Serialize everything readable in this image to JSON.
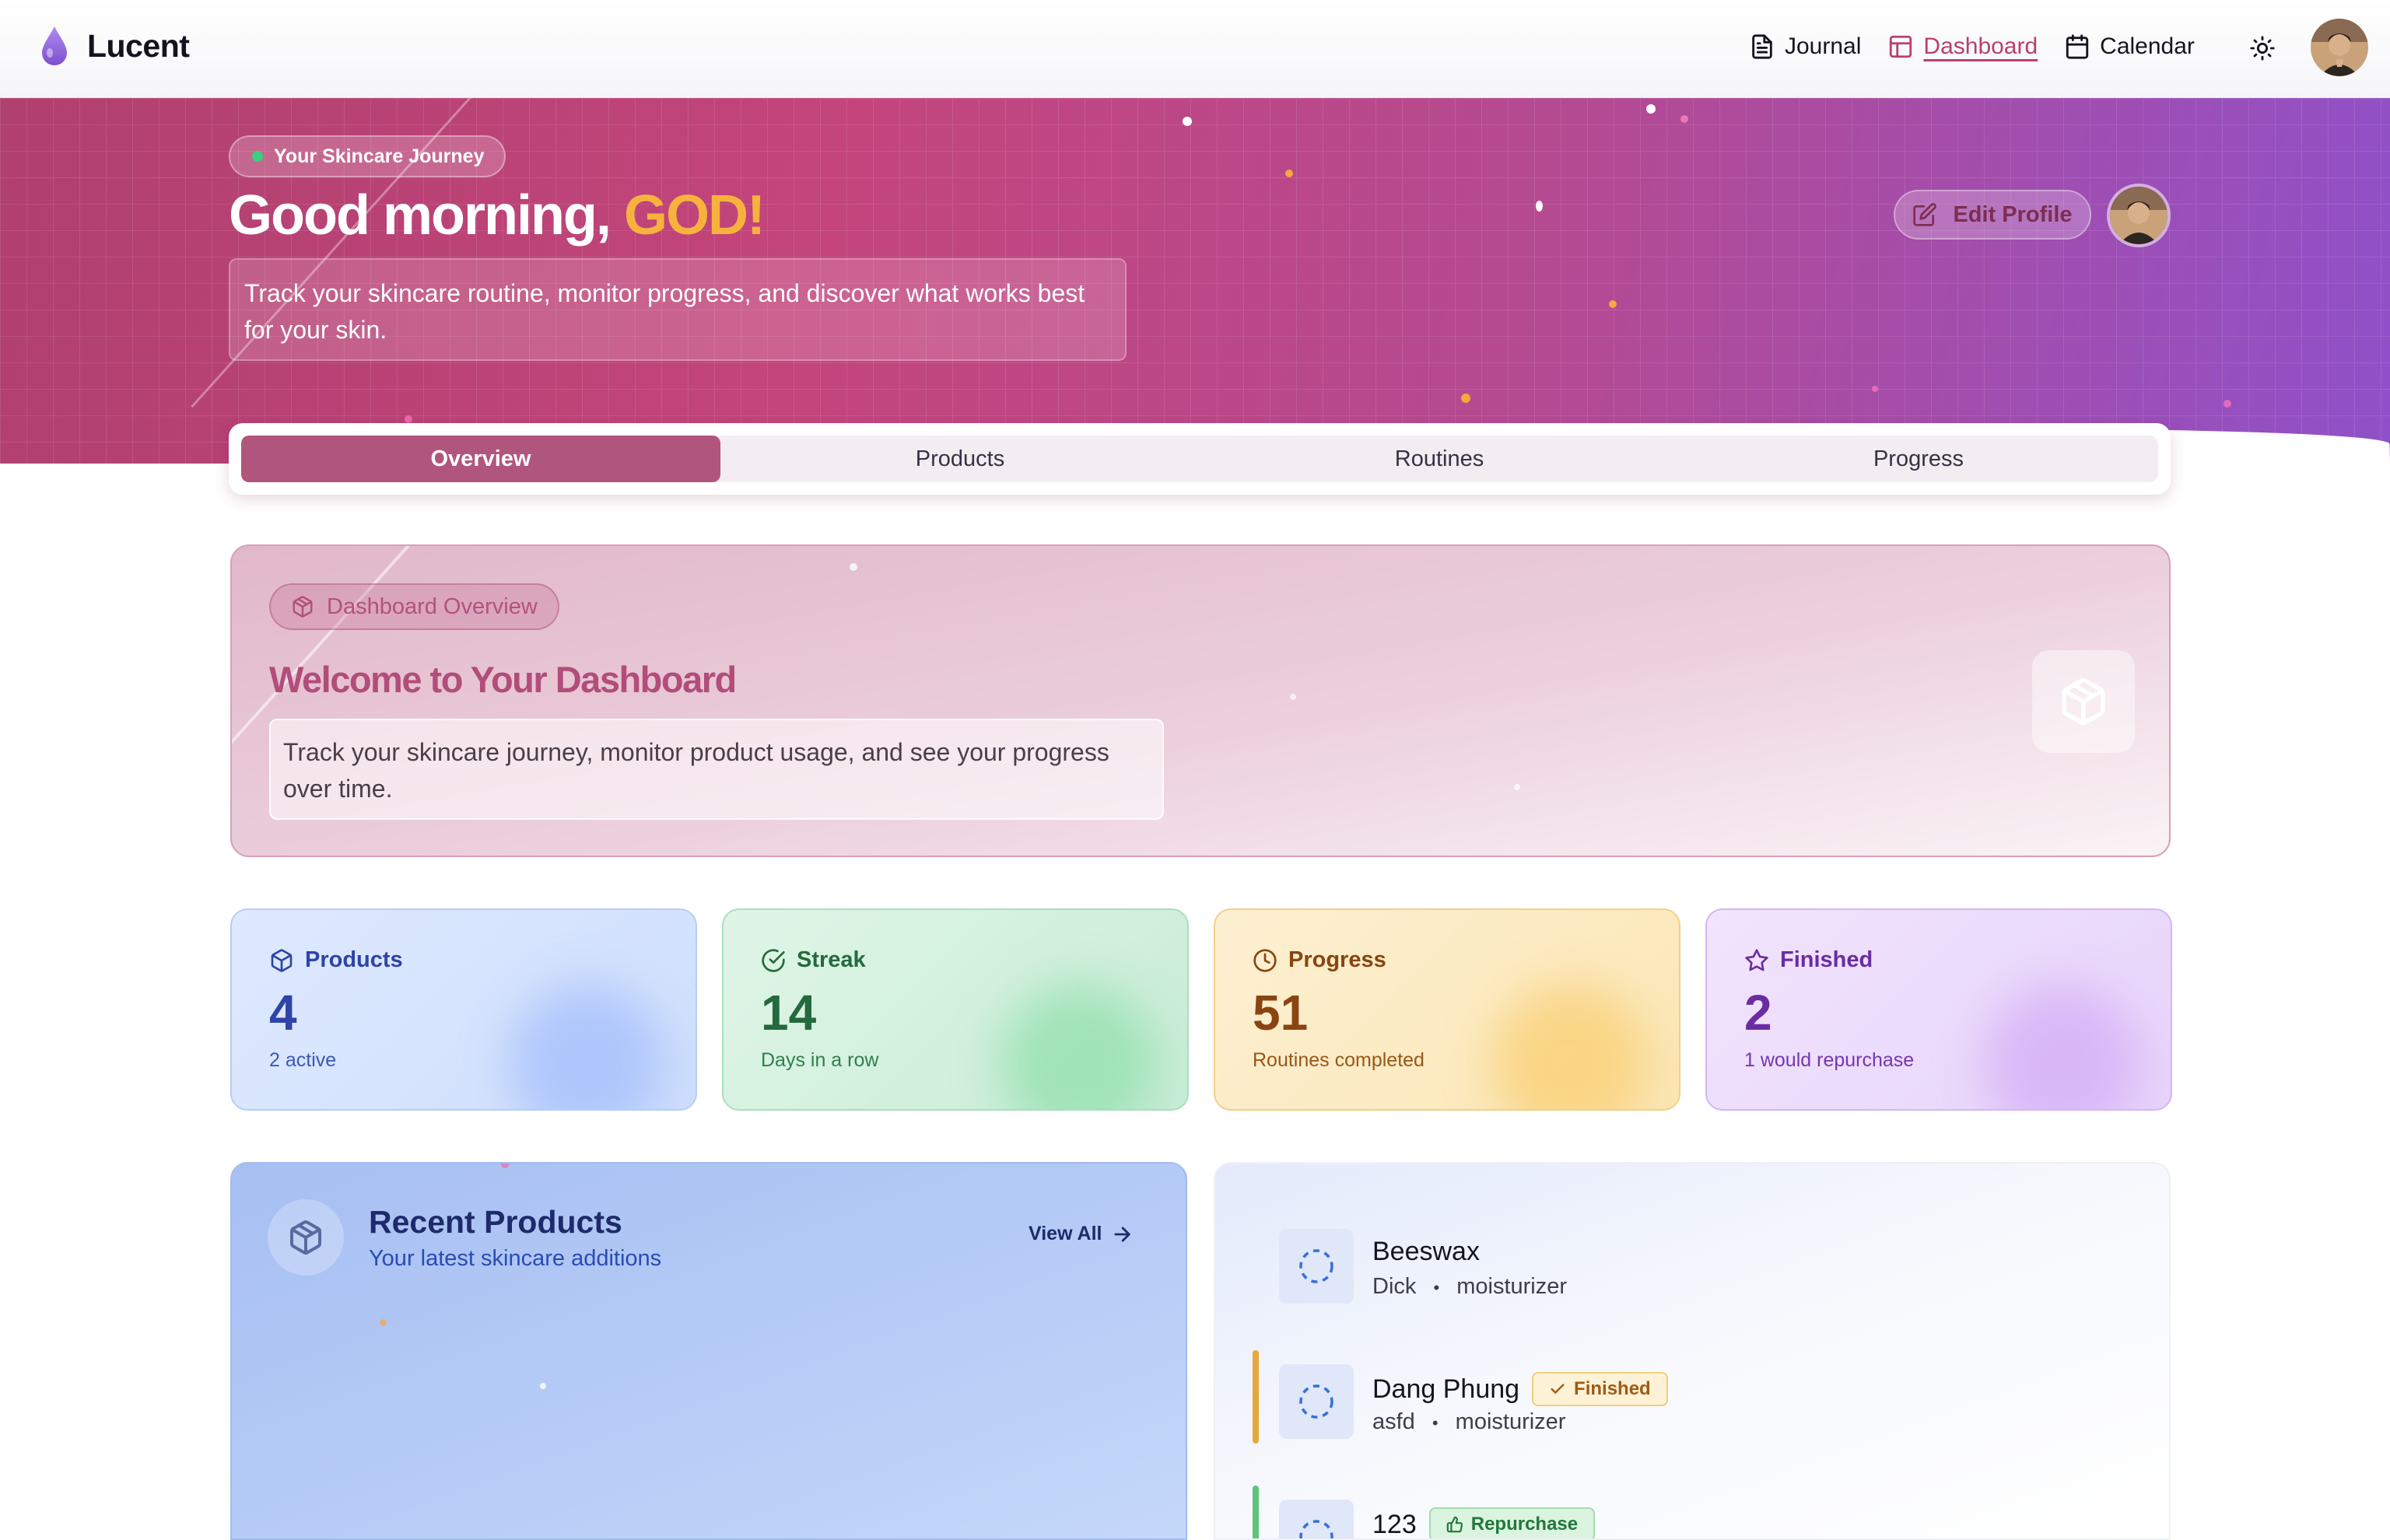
{
  "app": {
    "name": "Lucent"
  },
  "nav": {
    "links": [
      {
        "label": "Journal",
        "icon": "file-text-icon"
      },
      {
        "label": "Dashboard",
        "icon": "layout-icon",
        "active": true
      },
      {
        "label": "Calendar",
        "icon": "calendar-icon"
      }
    ],
    "theme_icon": "sun-icon"
  },
  "hero": {
    "pill": "Your Skincare Journey",
    "greeting": "Good morning,",
    "name": "GOD!",
    "description": "Track your skincare routine, monitor progress, and discover what works best for your skin.",
    "edit_profile": "Edit Profile"
  },
  "tabs": [
    {
      "label": "Overview",
      "active": true
    },
    {
      "label": "Products"
    },
    {
      "label": "Routines"
    },
    {
      "label": "Progress"
    }
  ],
  "welcome": {
    "chip": "Dashboard Overview",
    "title": "Welcome to Your Dashboard",
    "description": "Track your skincare journey, monitor product usage, and see your progress over time."
  },
  "stats": [
    {
      "label": "Products",
      "value": "4",
      "sub": "2 active",
      "icon": "package-icon"
    },
    {
      "label": "Streak",
      "value": "14",
      "sub": "Days in a row",
      "icon": "check-circle-icon"
    },
    {
      "label": "Progress",
      "value": "51",
      "sub": "Routines completed",
      "icon": "clock-icon"
    },
    {
      "label": "Finished",
      "value": "2",
      "sub": "1 would repurchase",
      "icon": "star-icon"
    }
  ],
  "recent": {
    "title": "Recent Products",
    "subtitle": "Your latest skincare additions",
    "view_all": "View All"
  },
  "products": [
    {
      "name": "Beeswax",
      "brand": "Dick",
      "sep": "•",
      "category": "moisturizer",
      "badge": ""
    },
    {
      "name": "Dang Phung",
      "brand": "asfd",
      "sep": "•",
      "category": "moisturizer",
      "badge": "Finished"
    },
    {
      "name": "123",
      "brand": "",
      "sep": "",
      "category": "",
      "badge": "Repurchase"
    }
  ],
  "colors": {
    "accent": "#b0567c",
    "name_highlight": "#f6b23c",
    "finished_bar": "#e6a83a",
    "repurchase_bar": "#5cc57a"
  }
}
